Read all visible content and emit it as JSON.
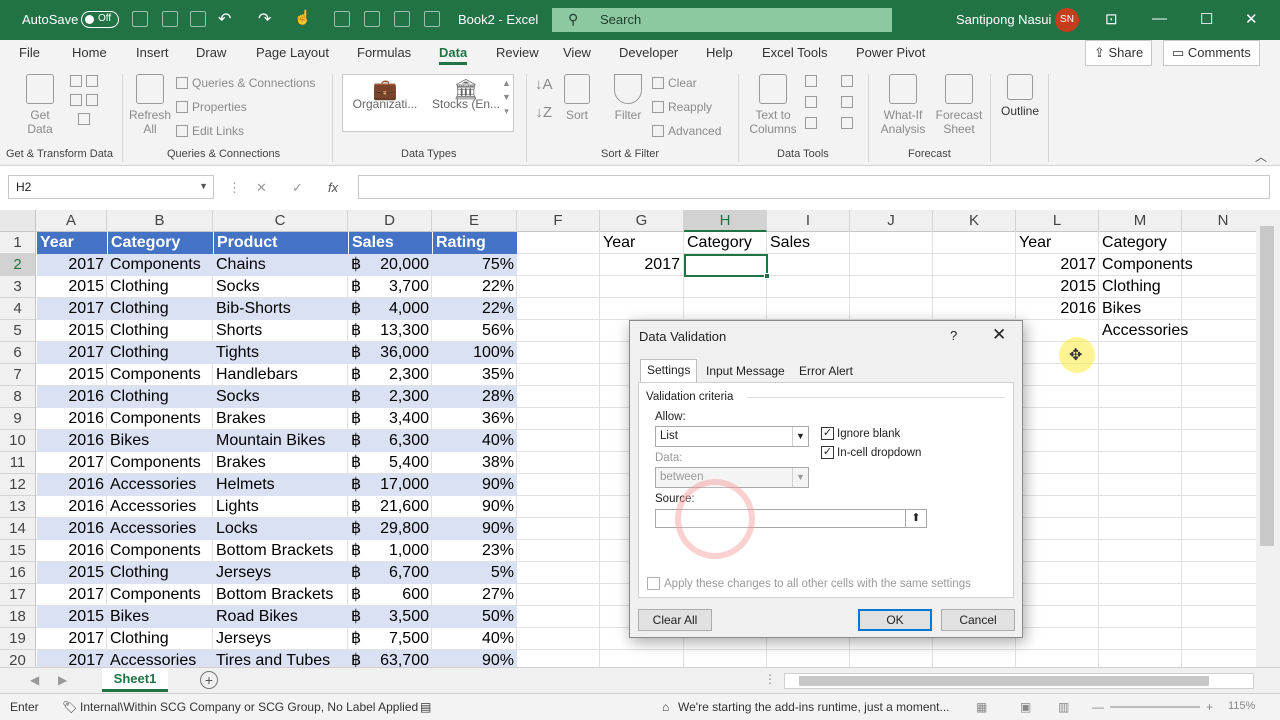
{
  "titlebar": {
    "autosave_label": "AutoSave",
    "autosave_state": "Off",
    "doc_title": "Book2 - Excel",
    "search_placeholder": "Search",
    "user_name": "Santipong Nasui",
    "user_initials": "SN"
  },
  "ribbon_tabs": [
    "File",
    "Home",
    "Insert",
    "Draw",
    "Page Layout",
    "Formulas",
    "Data",
    "Review",
    "View",
    "Developer",
    "Help",
    "Excel Tools",
    "Power Pivot"
  ],
  "active_tab": "Data",
  "share_label": "Share",
  "comments_label": "Comments",
  "ribbon": {
    "get_data": "Get\nData",
    "queries_connections": "Queries & Connections",
    "properties": "Properties",
    "edit_links": "Edit Links",
    "refresh_all": "Refresh\nAll",
    "org_label": "Organizati...",
    "stocks_label": "Stocks (En...",
    "clear": "Clear",
    "reapply": "Reapply",
    "advanced": "Advanced",
    "sort": "Sort",
    "filter": "Filter",
    "text_to_columns": "Text to\nColumns",
    "what_if": "What-If\nAnalysis",
    "forecast_sheet": "Forecast\nSheet",
    "outline": "Outline",
    "groups": [
      "Get & Transform Data",
      "Queries & Connections",
      "Data Types",
      "Sort & Filter",
      "Data Tools",
      "Forecast"
    ]
  },
  "formula_bar": {
    "name_box": "H2",
    "formula": ""
  },
  "columns": [
    "A",
    "B",
    "C",
    "D",
    "E",
    "F",
    "G",
    "H",
    "I",
    "J",
    "K",
    "L",
    "M",
    "N"
  ],
  "selected_column": "H",
  "rows": [
    1,
    2,
    3,
    4,
    5,
    6,
    7,
    8,
    9,
    10,
    11,
    12,
    13,
    14,
    15,
    16,
    17,
    18,
    19,
    20
  ],
  "selected_row": 2,
  "table_header": [
    "Year",
    "Category",
    "Product",
    "Sales",
    "Rating"
  ],
  "table_rows": [
    [
      "2017",
      "Components",
      "Chains",
      "฿",
      "20,000",
      "75%"
    ],
    [
      "2015",
      "Clothing",
      "Socks",
      "฿",
      "3,700",
      "22%"
    ],
    [
      "2017",
      "Clothing",
      "Bib-Shorts",
      "฿",
      "4,000",
      "22%"
    ],
    [
      "2015",
      "Clothing",
      "Shorts",
      "฿",
      "13,300",
      "56%"
    ],
    [
      "2017",
      "Clothing",
      "Tights",
      "฿",
      "36,000",
      "100%"
    ],
    [
      "2015",
      "Components",
      "Handlebars",
      "฿",
      "2,300",
      "35%"
    ],
    [
      "2016",
      "Clothing",
      "Socks",
      "฿",
      "2,300",
      "28%"
    ],
    [
      "2016",
      "Components",
      "Brakes",
      "฿",
      "3,400",
      "36%"
    ],
    [
      "2016",
      "Bikes",
      "Mountain Bikes",
      "฿",
      "6,300",
      "40%"
    ],
    [
      "2017",
      "Components",
      "Brakes",
      "฿",
      "5,400",
      "38%"
    ],
    [
      "2016",
      "Accessories",
      "Helmets",
      "฿",
      "17,000",
      "90%"
    ],
    [
      "2016",
      "Accessories",
      "Lights",
      "฿",
      "21,600",
      "90%"
    ],
    [
      "2016",
      "Accessories",
      "Locks",
      "฿",
      "29,800",
      "90%"
    ],
    [
      "2016",
      "Components",
      "Bottom Brackets",
      "฿",
      "1,000",
      "23%"
    ],
    [
      "2015",
      "Clothing",
      "Jerseys",
      "฿",
      "6,700",
      "5%"
    ],
    [
      "2017",
      "Components",
      "Bottom Brackets",
      "฿",
      "600",
      "27%"
    ],
    [
      "2015",
      "Bikes",
      "Road Bikes",
      "฿",
      "3,500",
      "50%"
    ],
    [
      "2017",
      "Clothing",
      "Jerseys",
      "฿",
      "7,500",
      "40%"
    ],
    [
      "2017",
      "Accessories",
      "Tires and Tubes",
      "฿",
      "63,700",
      "90%"
    ]
  ],
  "criteria": {
    "g1": "Year",
    "h1": "Category",
    "i1": "Sales",
    "g2": "2017"
  },
  "lists": {
    "l1": "Year",
    "m1": "Category",
    "years": [
      "2017",
      "2015",
      "2016"
    ],
    "categories": [
      "Components",
      "Clothing",
      "Bikes",
      "Accessories"
    ]
  },
  "sheet_tab": "Sheet1",
  "status": {
    "mode": "Enter",
    "label": "Internal\\Within SCG Company or SCG Group, No Label Applied",
    "message": "We're starting the add-ins runtime, just a moment...",
    "zoom": "115%"
  },
  "dialog": {
    "title": "Data Validation",
    "help": "?",
    "tabs": [
      "Settings",
      "Input Message",
      "Error Alert"
    ],
    "criteria_heading": "Validation criteria",
    "allow_label": "Allow:",
    "allow_value": "List",
    "ignore_blank": "Ignore blank",
    "in_cell_dropdown": "In-cell dropdown",
    "data_label": "Data:",
    "data_value": "between",
    "source_label": "Source:",
    "source_value": "",
    "apply_all": "Apply these changes to all other cells with the same settings",
    "clear_all": "Clear All",
    "ok": "OK",
    "cancel": "Cancel"
  }
}
